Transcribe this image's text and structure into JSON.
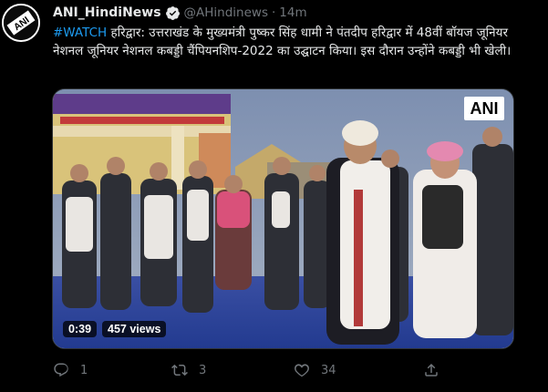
{
  "tweet": {
    "author": {
      "name": "ANI_HindiNews",
      "handle": "@AHindinews",
      "time": "14m",
      "verified": true,
      "avatar_text": "ANI"
    },
    "hashtag": "#WATCH",
    "body": " हरिद्वार: उत्तराखंड के मुख्यमंत्री पुष्कर सिंह धामी ने पंतदीप हरिद्वार में 48वीं बॉयज जूनियर नेशनल जूनियर नेशनल कबड्डी चैंपियनशिप-2022 का उद्घाटन किया। इस दौरान उन्होंने कबड्डी भी खेली।",
    "media": {
      "watermark": "ANI",
      "duration": "0:39",
      "views": "457 views"
    },
    "stats": {
      "replies": "1",
      "retweets": "3",
      "likes": "34"
    }
  },
  "colors": {
    "accent": "#1d9bf0",
    "muted": "#71767b",
    "text": "#e7e9ea",
    "background": "#000000"
  },
  "icons": [
    "verified-badge-icon",
    "reply-icon",
    "retweet-icon",
    "like-icon",
    "share-icon"
  ]
}
